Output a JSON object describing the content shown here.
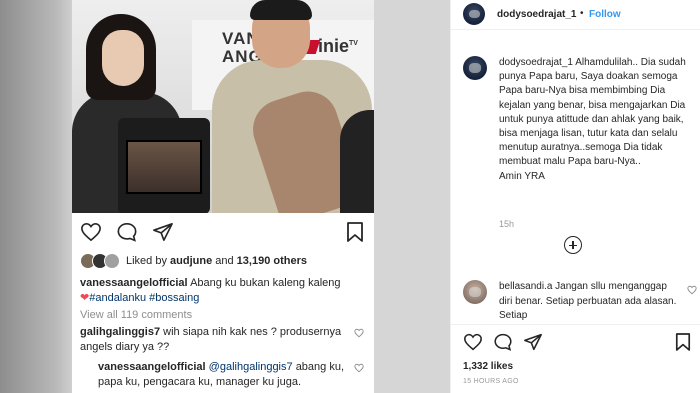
{
  "left_post": {
    "photo": {
      "banner_text_line1": "VANESS",
      "banner_text_line2": "ANGEL",
      "brand": "inie",
      "brand_suffix": "TV"
    },
    "likes": {
      "liked_by_prefix": "Liked by ",
      "liked_user": "audjune",
      "and": " and ",
      "others": "13,190 others"
    },
    "caption": {
      "username": "vanessaangelofficial",
      "text": "Abang ku bukan kaleng kaleng",
      "heart": "❤",
      "tags": "#andalanku #bossaing"
    },
    "view_all": "View all 119 comments",
    "comment1": {
      "username": "galihgalinggis7",
      "text": "wih siapa nih kak nes ? produsernya angels diary ya ??"
    },
    "reply1": {
      "username": "vanessaangelofficial",
      "mention": "@galihgalinggis7",
      "text": "abang ku, papa ku, pengacara ku, manager ku juga."
    }
  },
  "right_panel": {
    "header": {
      "username": "dodysoedrajat_1",
      "separator": "•",
      "follow": "Follow"
    },
    "main_comment": {
      "username": "dodysoedrajat_1",
      "text": "Alhamdulilah.. Dia sudah punya Papa baru, Saya doakan semoga Papa baru-Nya bisa membimbing Dia kejalan yang benar, bisa mengajarkan Dia untuk punya atittude dan ahlak yang baik, bisa menjaga lisan, tutur kata dan selalu menutup auratnya..semoga Dia tidak membuat malu Papa baru-Nya..",
      "signoff": "Amin YRA",
      "time": "15h"
    },
    "comment2": {
      "username": "bellasandi.a",
      "text": "Jangan sllu menganggap diri benar. Setiap perbuatan ada alasan. Setiap"
    },
    "likes_count": "1,332 likes",
    "timestamp": "15 HOURS AGO"
  },
  "colors": {
    "link_blue": "#3897f0",
    "text_dark": "#262626",
    "muted": "#8e8e8e",
    "heart_red": "#ed4956"
  }
}
